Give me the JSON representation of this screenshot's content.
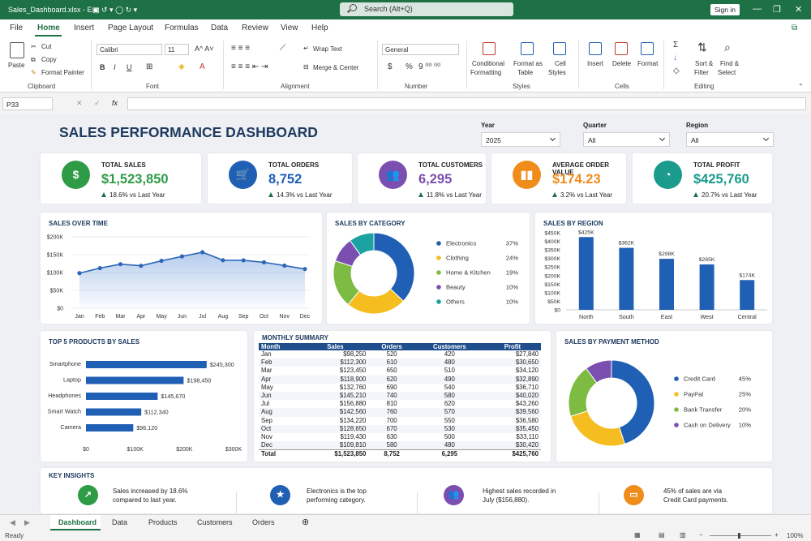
{
  "window": {
    "filename": "Sales_Dashboard.xlsx - Exc",
    "search_placeholder": "Search (Alt+Q)",
    "signin": "Sign in"
  },
  "menu": [
    "File",
    "Home",
    "Insert",
    "Page Layout",
    "Formulas",
    "Data",
    "Review",
    "View",
    "Help"
  ],
  "ribbon": {
    "clipboard": {
      "paste": "Paste",
      "cut": "Cut",
      "copy": "Copy",
      "format_painter": "Format Painter",
      "group": "Clipboard"
    },
    "font": {
      "name": "Calibri",
      "size": "11",
      "group": "Font",
      "bold": "B",
      "italic": "I",
      "underline": "U"
    },
    "alignment": {
      "wrap": "Wrap Text",
      "merge": "Merge & Center",
      "group": "Alignment"
    },
    "number": {
      "format": "General",
      "group": "Number",
      "currency": "$",
      "percent": "%"
    },
    "styles": {
      "conditional1": "Conditional",
      "conditional2": "Formatting",
      "table1": "Format as",
      "table2": "Table",
      "cell1": "Cell",
      "cell2": "Styles",
      "group": "Styles"
    },
    "cells": {
      "insert": "Insert",
      "delete": "Delete",
      "format": "Format",
      "group": "Cells"
    },
    "editing": {
      "sort1": "Sort &",
      "sort2": "Filter",
      "find1": "Find &",
      "find2": "Select",
      "group": "Editing"
    }
  },
  "formula_bar": {
    "cell": "P33",
    "fx": "fx"
  },
  "dashboard": {
    "title": "SALES PERFORMANCE DASHBOARD",
    "filters": [
      {
        "label": "Year",
        "value": "2025"
      },
      {
        "label": "Quarter",
        "value": "All"
      },
      {
        "label": "Region",
        "value": "All"
      }
    ],
    "kpis": [
      {
        "label": "TOTAL SALES",
        "value": "$1,523,850",
        "change": "18.6% vs Last Year",
        "icon": "dollar-icon",
        "color": "#2e9b47"
      },
      {
        "label": "TOTAL ORDERS",
        "value": "8,752",
        "change": "14.3% vs Last Year",
        "icon": "cart-icon",
        "color": "#1f5fb4"
      },
      {
        "label": "TOTAL CUSTOMERS",
        "value": "6,295",
        "change": "11.8% vs Last Year",
        "icon": "users-icon",
        "color": "#7b4fb0"
      },
      {
        "label": "AVERAGE ORDER VALUE",
        "value": "$174.23",
        "change": "3.2% vs Last Year",
        "icon": "bar-chart-icon",
        "color": "#f08c1a"
      },
      {
        "label": "TOTAL PROFIT",
        "value": "$425,760",
        "change": "20.7% vs Last Year",
        "icon": "pie-icon",
        "color": "#1a9b8c"
      }
    ],
    "insights_title": "KEY INSIGHTS",
    "insights": [
      {
        "line1": "Sales increased by 18.6%",
        "line2": "compared to last year.",
        "icon": "trend-up-icon",
        "color": "#2e9b47"
      },
      {
        "line1": "Electronics is the top",
        "line2": "performing category.",
        "icon": "star-icon",
        "color": "#1f5fb4"
      },
      {
        "line1": "Highest sales recorded in",
        "line2": "July ($156,880).",
        "icon": "users-icon",
        "color": "#7b4fb0"
      },
      {
        "line1": "45% of sales are via",
        "line2": "Credit Card payments.",
        "icon": "card-icon",
        "color": "#f08c1a"
      }
    ]
  },
  "sheet_tabs": [
    "Dashboard",
    "Data",
    "Products",
    "Customers",
    "Orders"
  ],
  "status": {
    "ready": "Ready",
    "zoom": "100%"
  },
  "chart_data": [
    {
      "id": "sales-over-time",
      "type": "area",
      "title": "SALES OVER TIME",
      "categories": [
        "Jan",
        "Feb",
        "Mar",
        "Apr",
        "May",
        "Jun",
        "Jul",
        "Aug",
        "Sep",
        "Oct",
        "Nov",
        "Dec"
      ],
      "values": [
        98250,
        112300,
        123450,
        118900,
        132760,
        145210,
        156880,
        134560,
        134220,
        128650,
        119430,
        109810
      ],
      "yticks": [
        "$0",
        "$50K",
        "$100K",
        "$150K",
        "$200K"
      ],
      "ylim": [
        0,
        200000
      ]
    },
    {
      "id": "sales-by-category",
      "type": "pie",
      "title": "SALES BY CATEGORY",
      "labels": [
        "Electronics",
        "Clothing",
        "Home & Kitchen",
        "Beauty",
        "Others"
      ],
      "values": [
        37,
        24,
        19,
        10,
        10
      ],
      "pct": [
        "37%",
        "24%",
        "19%",
        "10%",
        "10%"
      ],
      "colors": [
        "#1f5fb4",
        "#f5bd1f",
        "#7dbb42",
        "#7b4fb0",
        "#1aa3a0"
      ]
    },
    {
      "id": "sales-by-region",
      "type": "bar",
      "title": "SALES BY REGION",
      "categories": [
        "North",
        "South",
        "East",
        "West",
        "Central"
      ],
      "values": [
        425,
        362,
        298,
        265,
        174
      ],
      "labels": [
        "$425K",
        "$362K",
        "$298K",
        "$265K",
        "$174K"
      ],
      "yticks": [
        "$0",
        "$50K",
        "$100K",
        "$150K",
        "$200K",
        "$250K",
        "$300K",
        "$350K",
        "$400K",
        "$450K"
      ],
      "ylim": [
        0,
        450
      ]
    },
    {
      "id": "top-products",
      "type": "bar",
      "orientation": "horizontal",
      "title": "TOP 5 PRODUCTS BY SALES",
      "categories": [
        "Smartphone",
        "Laptop",
        "Headphones",
        "Smart Watch",
        "Camera"
      ],
      "values": [
        245300,
        198450,
        145670,
        112340,
        96120
      ],
      "labels": [
        "$245,300",
        "$198,450",
        "$145,670",
        "$112,340",
        "$96,120"
      ],
      "xticks": [
        "$0",
        "$100K",
        "$200K",
        "$300K"
      ],
      "xlim": [
        0,
        300000
      ]
    },
    {
      "id": "monthly-summary",
      "type": "table",
      "title": "MONTHLY SUMMARY",
      "columns": [
        "Month",
        "Sales",
        "Orders",
        "Customers",
        "Profit"
      ],
      "rows": [
        [
          "Jan",
          "$98,250",
          "520",
          "420",
          "$27,840"
        ],
        [
          "Feb",
          "$112,300",
          "610",
          "480",
          "$30,650"
        ],
        [
          "Mar",
          "$123,450",
          "650",
          "510",
          "$34,120"
        ],
        [
          "Apr",
          "$118,900",
          "620",
          "490",
          "$32,890"
        ],
        [
          "May",
          "$132,760",
          "690",
          "540",
          "$36,710"
        ],
        [
          "Jun",
          "$145,210",
          "740",
          "580",
          "$40,020"
        ],
        [
          "Jul",
          "$156,880",
          "810",
          "620",
          "$43,260"
        ],
        [
          "Aug",
          "$142,560",
          "760",
          "570",
          "$39,560"
        ],
        [
          "Sep",
          "$134,220",
          "700",
          "550",
          "$36,580"
        ],
        [
          "Oct",
          "$128,650",
          "670",
          "530",
          "$35,450"
        ],
        [
          "Nov",
          "$119,430",
          "630",
          "500",
          "$33,110"
        ],
        [
          "Dec",
          "$109,810",
          "580",
          "480",
          "$30,420"
        ]
      ],
      "total": [
        "Total",
        "$1,523,850",
        "8,752",
        "6,295",
        "$425,760"
      ]
    },
    {
      "id": "payment-method",
      "type": "pie",
      "title": "SALES BY PAYMENT METHOD",
      "labels": [
        "Credit Card",
        "PayPal",
        "Bank Transfer",
        "Cash on Delivery"
      ],
      "values": [
        45,
        25,
        20,
        10
      ],
      "pct": [
        "45%",
        "25%",
        "20%",
        "10%"
      ],
      "colors": [
        "#1f5fb4",
        "#f5bd1f",
        "#7dbb42",
        "#7b4fb0"
      ]
    }
  ]
}
